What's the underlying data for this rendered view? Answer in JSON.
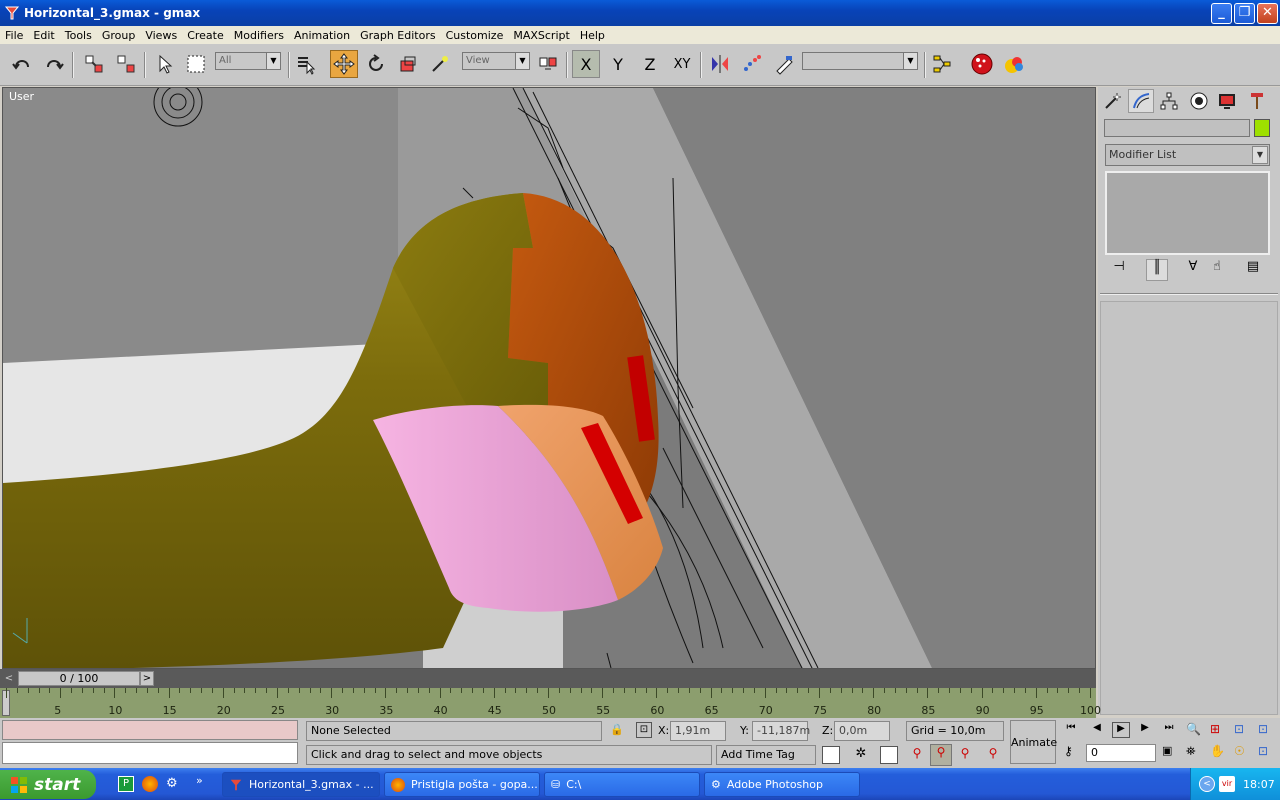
{
  "window": {
    "title": "Horizontal_3.gmax - gmax",
    "minimize": "_",
    "maximize": "❐",
    "close": "✕"
  },
  "menu": [
    "File",
    "Edit",
    "Tools",
    "Group",
    "Views",
    "Create",
    "Modifiers",
    "Animation",
    "Graph Editors",
    "Customize",
    "MAXScript",
    "Help"
  ],
  "toolbar": {
    "selection_filter": "All",
    "ref_coord": "View",
    "axis_x": "X",
    "axis_y": "Y",
    "axis_z": "Z",
    "axis_xy": "XY"
  },
  "viewport": {
    "label": "User"
  },
  "command_panel": {
    "modifier_list": "Modifier List",
    "color_swatch": "#9ee000"
  },
  "timeline": {
    "frame_display": "0 / 100",
    "ticks": [
      5,
      10,
      15,
      20,
      25,
      30,
      35,
      40,
      45,
      50,
      55,
      60,
      65,
      70,
      75,
      80,
      85,
      90,
      95,
      100
    ]
  },
  "status": {
    "selection": "None Selected",
    "prompt": "Click and drag to select and move objects",
    "x_label": "X:",
    "x_value": "1,91m",
    "y_label": "Y:",
    "y_value": "-11,187m",
    "z_label": "Z:",
    "z_value": "0,0m",
    "grid": "Grid = 10,0m",
    "add_time_tag": "Add Time Tag",
    "animate": "Animate",
    "frame": "0"
  },
  "taskbar": {
    "start": "start",
    "tasks": [
      "Horizontal_3.gmax - ...",
      "Pristigla pošta - gopa...",
      "C:\\",
      "Adobe Photoshop"
    ],
    "clock": "18:07"
  }
}
